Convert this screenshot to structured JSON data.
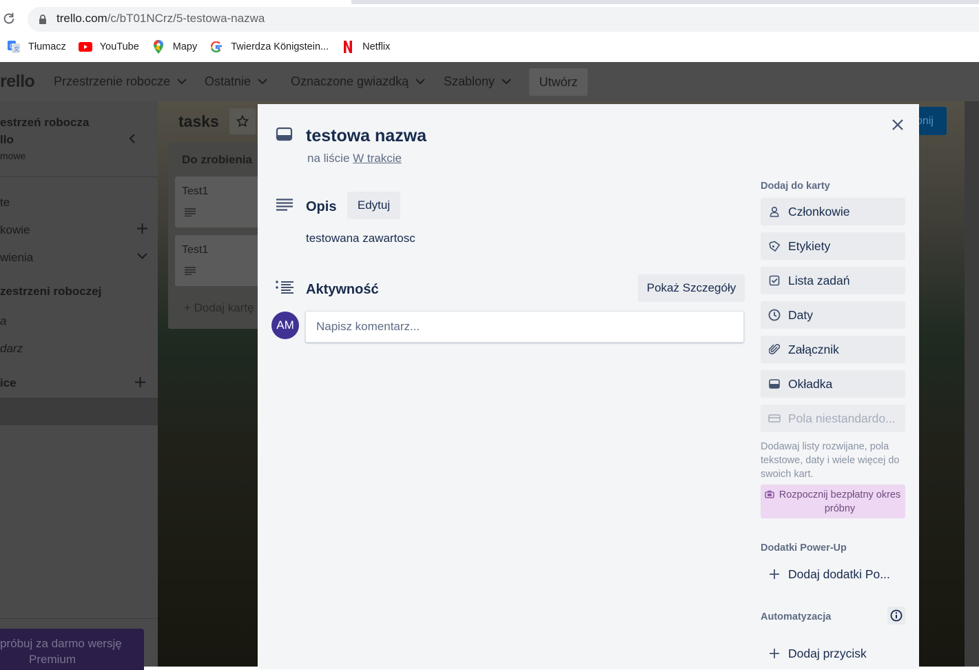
{
  "browser": {
    "url_host": "trello.com",
    "url_path": "/c/bT01NCrz/5-testowa-nazwa",
    "bookmarks": [
      {
        "label": "Tłumacz",
        "icon": "google-translate-icon"
      },
      {
        "label": "YouTube",
        "icon": "youtube-icon"
      },
      {
        "label": "Mapy",
        "icon": "google-maps-icon"
      },
      {
        "label": "Twierdza Königstein...",
        "icon": "google-icon"
      },
      {
        "label": "Netflix",
        "icon": "netflix-icon"
      }
    ]
  },
  "header": {
    "logo": "rello",
    "nav": [
      "Przestrzenie robocze",
      "Ostatnie",
      "Oznaczone gwiazdką",
      "Szablony"
    ],
    "create": "Utwórz"
  },
  "sidebar": {
    "workspace_line1": "estrzeń robocza",
    "workspace_line2": "llo",
    "workspace_line3": "mowe",
    "items": [
      "te",
      "kowie",
      "wienia"
    ],
    "section": "zestrzeni roboczej",
    "views": [
      "a",
      "darz"
    ],
    "boards_header": "ice",
    "premium_line1": "próbuj za darmo wersję",
    "premium_line2": "Premium"
  },
  "board": {
    "title": "tasks",
    "list_title": "Do zrobienia",
    "cards": [
      "Test1",
      "Test1"
    ],
    "add_card": "Dodaj kartę",
    "share": "onij"
  },
  "modal": {
    "title": "testowa nazwa",
    "in_list_prefix": "na liście",
    "list_name": "W trakcie",
    "description_heading": "Opis",
    "edit": "Edytuj",
    "description": "testowana zawartosc",
    "activity_heading": "Aktywność",
    "show_details": "Pokaż Szczegóły",
    "avatar_initials": "AM",
    "comment_placeholder": "Napisz komentarz...",
    "add_to_card": "Dodaj do karty",
    "actions": [
      {
        "label": "Członkowie",
        "icon": "person-icon"
      },
      {
        "label": "Etykiety",
        "icon": "label-icon"
      },
      {
        "label": "Lista zadań",
        "icon": "checklist-icon"
      },
      {
        "label": "Daty",
        "icon": "clock-icon"
      },
      {
        "label": "Załącznik",
        "icon": "paperclip-icon"
      },
      {
        "label": "Okładka",
        "icon": "cover-icon"
      }
    ],
    "custom_fields": "Pola niestandardo...",
    "custom_fields_help": "Dodawaj listy rozwijane, pola tekstowe, daty i wiele więcej do swoich kart.",
    "trial": "Rozpocznij bezpłatny okres próbny",
    "powerups_heading": "Dodatki Power-Up",
    "add_powerup": "Dodaj dodatki Po...",
    "automation_heading": "Automatyzacja",
    "add_button": "Dodaj przycisk"
  },
  "colors": {
    "modal_bg": "#f4f5f7",
    "avatar": "#403294",
    "trial_bg": "#eed7f3",
    "button_bg": "#e9ebee"
  }
}
